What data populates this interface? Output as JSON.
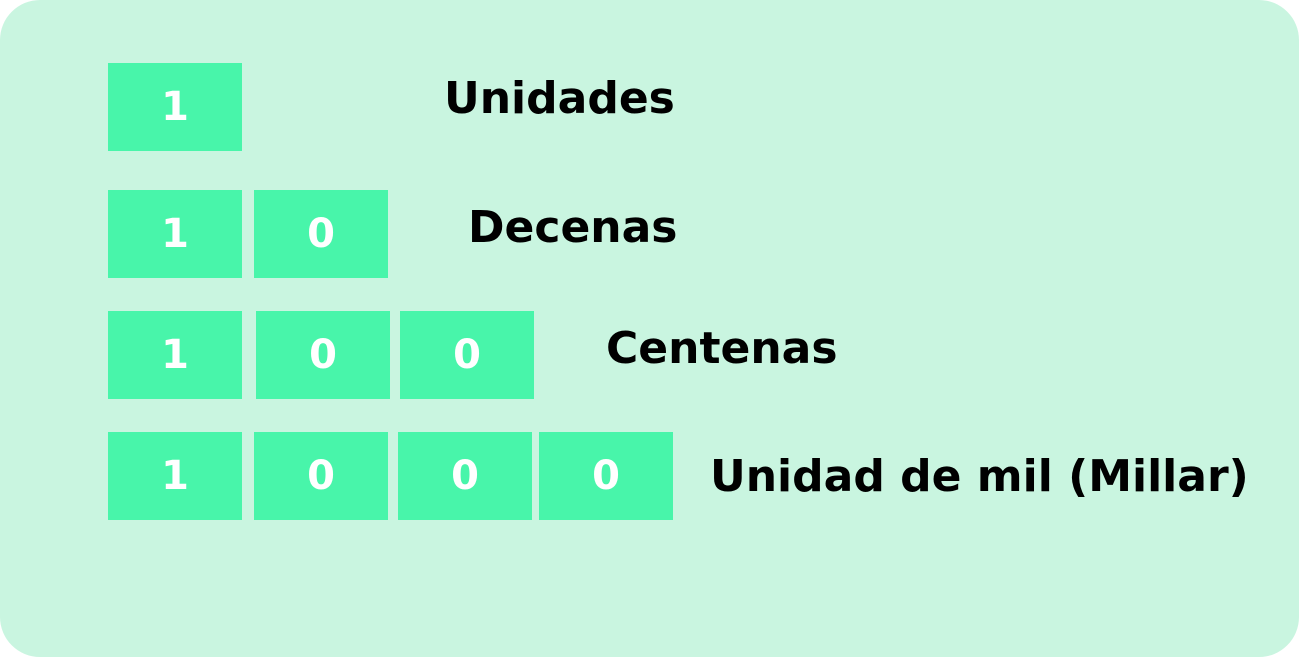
{
  "colors": {
    "background": "#c9f5e0",
    "cell": "#48f5aa",
    "digit": "#ffffff",
    "label": "#000000"
  },
  "rows": [
    {
      "digits": [
        "1"
      ],
      "label": "Unidades"
    },
    {
      "digits": [
        "1",
        "0"
      ],
      "label": "Decenas"
    },
    {
      "digits": [
        "1",
        "0",
        "0"
      ],
      "label": "Centenas"
    },
    {
      "digits": [
        "1",
        "0",
        "0",
        "0"
      ],
      "label": "Unidad de mil (Millar)"
    }
  ]
}
